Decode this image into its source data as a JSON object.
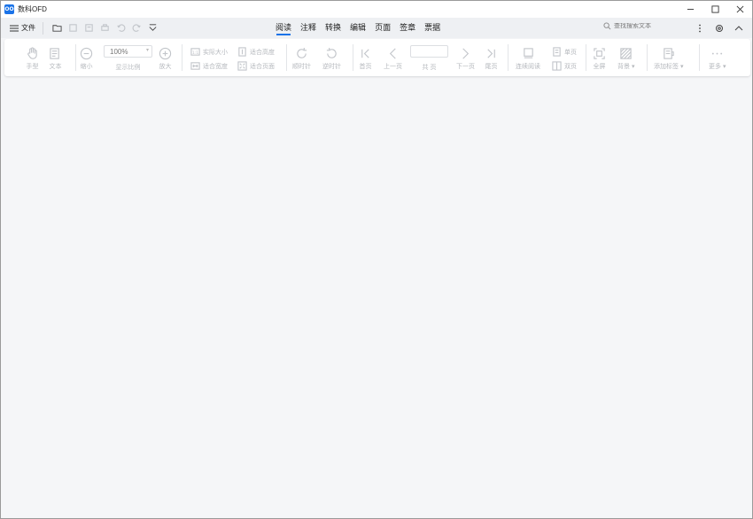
{
  "app": {
    "title": "数科OFD",
    "logo_text": "OO"
  },
  "menubar": {
    "file_label": "文件",
    "tabs": [
      {
        "label": "阅读",
        "active": true
      },
      {
        "label": "注释",
        "active": false
      },
      {
        "label": "转换",
        "active": false
      },
      {
        "label": "编辑",
        "active": false
      },
      {
        "label": "页面",
        "active": false
      },
      {
        "label": "签章",
        "active": false
      },
      {
        "label": "票据",
        "active": false
      }
    ],
    "search_placeholder": "查找搜索文本"
  },
  "ribbon": {
    "hand": "手型",
    "text": "文本",
    "zoom_out": "缩小",
    "zoom_value": "100%",
    "zoom_label": "显示比例",
    "zoom_in": "放大",
    "actual_size": "实际大小",
    "fit_width": "适合宽度",
    "fit_height": "适合高度",
    "fit_page": "适合页面",
    "rotate_cw": "顺时针",
    "rotate_ccw": "逆时针",
    "first_page": "首页",
    "prev_page": "上一页",
    "page_value": "",
    "page_label": "共 页",
    "next_page": "下一页",
    "last_page": "尾页",
    "continuous": "连续阅读",
    "single_page": "单页",
    "two_page": "双页",
    "fullscreen": "全屏",
    "background": "背景",
    "add_bookmark": "添加标签",
    "more": "更多"
  },
  "colors": {
    "accent": "#1a73e8",
    "disabled": "#b5b8bd",
    "canvas": "#f5f6f8"
  }
}
